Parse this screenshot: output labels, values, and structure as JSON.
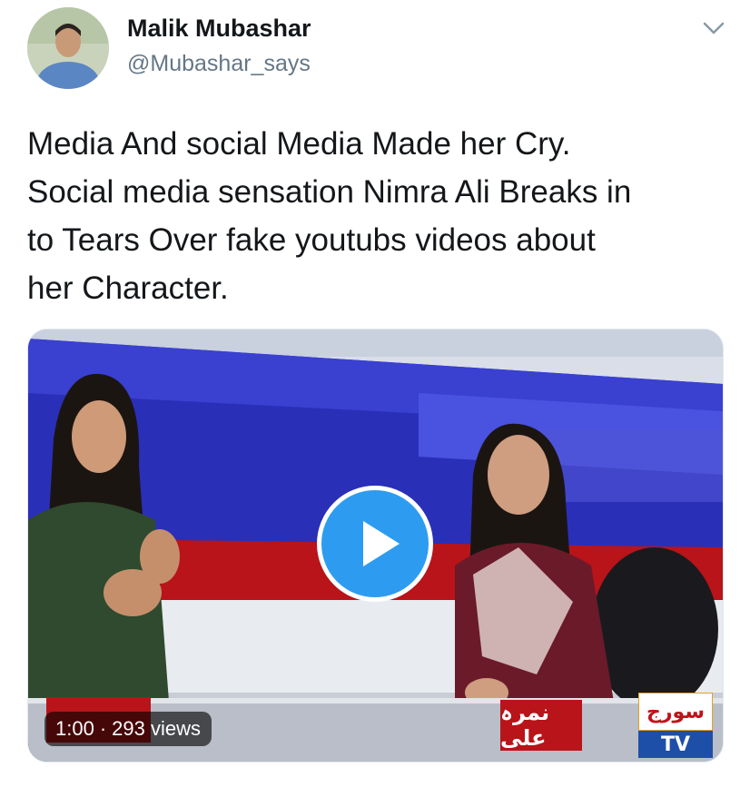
{
  "tweet": {
    "author": {
      "display_name": "Malik Mubashar",
      "handle": "@Mubashar_says"
    },
    "text": "Media And social Media Made her Cry.\nSocial media sensation Nimra Ali Breaks in\nto Tears Over fake youtubs videos about\nher Character.",
    "menu_icon": "chevron-down-icon"
  },
  "video": {
    "duration": "1:00",
    "views": "293 views",
    "play_icon": "play-icon",
    "channel_logo_urdu": "سورج",
    "channel_logo_tv": "TV",
    "lower_third_urdu": "نمرہ علی"
  },
  "colors": {
    "play_button": "#2d9cf0",
    "handle": "#657786",
    "studio_blue": "#2a2fb8",
    "lower_third_red": "#b8141a"
  }
}
